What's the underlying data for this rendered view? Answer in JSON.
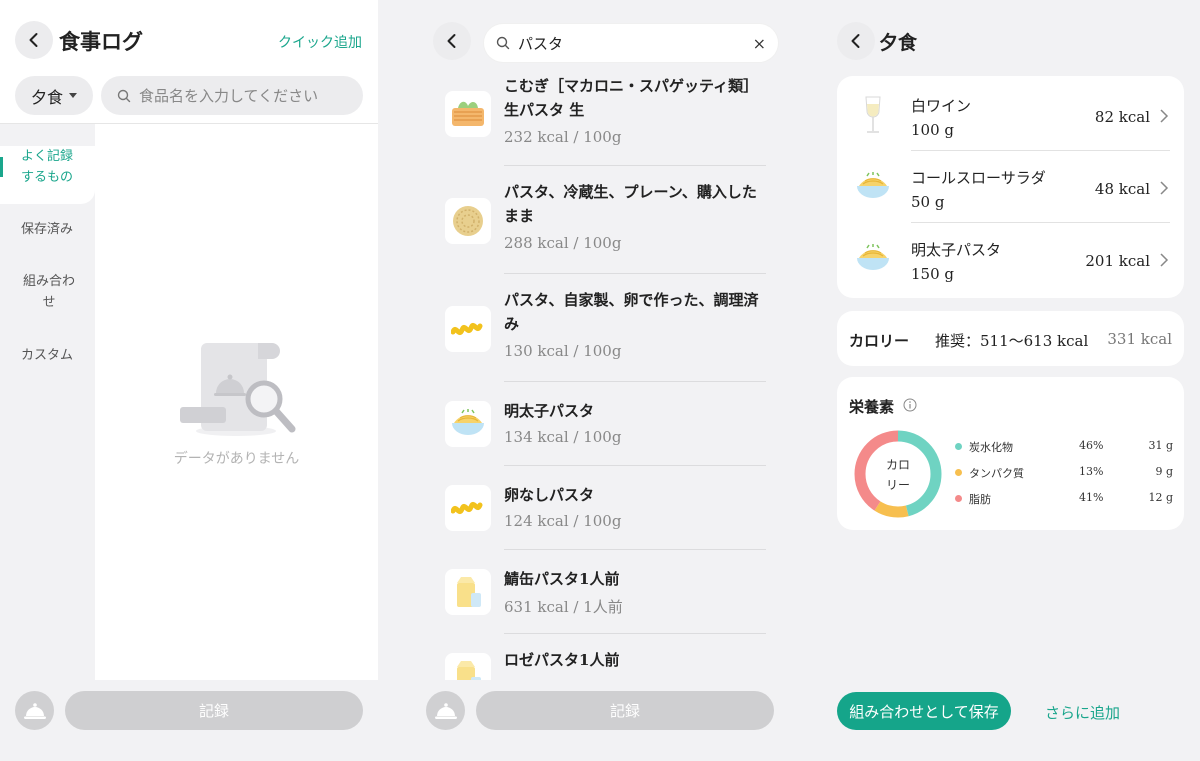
{
  "screen1": {
    "title": "食事ログ",
    "quick_add": "クイック追加",
    "meal_select": "夕食",
    "search_placeholder": "食品名を入力してください",
    "tabs": [
      {
        "label": "よく記録するもの",
        "active": true
      },
      {
        "label": "保存済み",
        "active": false
      },
      {
        "label": "組み合わせ",
        "active": false
      },
      {
        "label": "カスタム",
        "active": false
      }
    ],
    "empty_text": "データがありません",
    "record_label": "記録",
    "icons": [
      "chevron-left-icon",
      "search-icon",
      "caret-down-icon",
      "empty-search-icon",
      "cloche-icon"
    ]
  },
  "screen2": {
    "search_value": "パスタ",
    "clear_label": "×",
    "record_label": "記録",
    "results": [
      {
        "name": "こむぎ［マカロニ・スパゲッティ類］生パスタ 生",
        "kcal": "232 kcal / 100g",
        "icon": "noodle-block-icon"
      },
      {
        "name": "パスタ、冷蔵生、プレーン、購入したまま",
        "kcal": "288 kcal / 100g",
        "icon": "pasta-nest-icon"
      },
      {
        "name": "パスタ、自家製、卵で作った、調理済み",
        "kcal": "130 kcal / 100g",
        "icon": "fusilli-icon"
      },
      {
        "name": "明太子パスタ",
        "kcal": "134 kcal / 100g",
        "icon": "pasta-bowl-icon"
      },
      {
        "name": "卵なしパスタ",
        "kcal": "124 kcal / 100g",
        "icon": "fusilli-icon"
      },
      {
        "name": "鯖缶パスタ1人前",
        "kcal": "631 kcal / 1人前",
        "icon": "milk-carton-icon"
      },
      {
        "name": "ロゼパスタ1人前",
        "kcal": "",
        "icon": "milk-carton-icon"
      }
    ]
  },
  "screen3": {
    "title": "夕食",
    "foods": [
      {
        "name": "白ワイン",
        "amount": "100 g",
        "kcal": "82 kcal",
        "icon": "wine-glass-icon"
      },
      {
        "name": "コールスローサラダ",
        "amount": "50 g",
        "kcal": "48 kcal",
        "icon": "pasta-bowl-icon"
      },
      {
        "name": "明太子パスタ",
        "amount": "150 g",
        "kcal": "201 kcal",
        "icon": "pasta-bowl-icon"
      }
    ],
    "calorie_label": "カロリー",
    "calorie_recommend": "推奨：511〜613 kcal",
    "calorie_total": "331 kcal",
    "nutrients_title": "栄養素",
    "donut_label_line1": "カロ",
    "donut_label_line2": "リー",
    "nutrients": [
      {
        "name": "炭水化物",
        "pct": "46%",
        "gram": "31 g",
        "value": 46,
        "color": "#6fd3c2"
      },
      {
        "name": "タンパク質",
        "pct": "13%",
        "gram": "9 g",
        "value": 13,
        "color": "#f7bf4f"
      },
      {
        "name": "脂肪",
        "pct": "41%",
        "gram": "12 g",
        "value": 41,
        "color": "#f48a8a"
      }
    ],
    "save_combo": "組み合わせとして保存",
    "add_more": "さらに追加"
  },
  "colors": {
    "accent": "#1aa68c",
    "panel_bg": "#f2f2f4"
  }
}
